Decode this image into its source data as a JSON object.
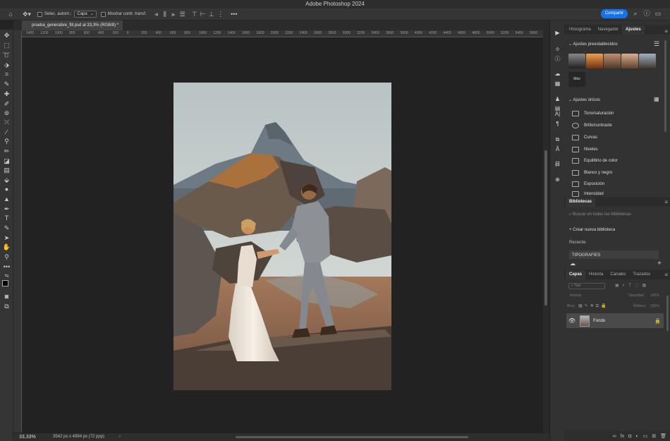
{
  "app": {
    "window_title": "Adobe Photoshop 2024",
    "share_label": "Compartir"
  },
  "options": {
    "auto_select_label": "Selec. autom.:",
    "layer_select": "Capa",
    "show_transform_label": "Mostrar contr. transf."
  },
  "document": {
    "tab_title": "prueba_generative_fill.psd al 33,3% (RGB/8) *",
    "zoom": "33,33%",
    "size_info": "3542 px x 4994 px (72 ppp)"
  },
  "ruler": {
    "ticks": [
      "1400",
      "1200",
      "1000",
      "800",
      "600",
      "400",
      "200",
      "0",
      "200",
      "400",
      "600",
      "800",
      "1000",
      "1200",
      "1400",
      "1600",
      "1800",
      "2000",
      "2200",
      "2400",
      "2600",
      "2800",
      "3000",
      "3200",
      "3400",
      "3600",
      "3800",
      "4000",
      "4200",
      "4400",
      "4600",
      "4800",
      "5000",
      "5200",
      "5400",
      "5600"
    ]
  },
  "panels": {
    "top_tabs": [
      "Histograma",
      "Navegador",
      "Ajustes"
    ],
    "presets_title": "Ajustes preestablecidos",
    "more_label": "Más",
    "single_title": "Ajustes únicos",
    "adjustments": [
      "Tono/saturación",
      "Brillo/contraste",
      "Curvas",
      "Niveles",
      "Equilibrio de color",
      "Blanco y negro",
      "Exposición",
      "Intensidad"
    ],
    "libraries_title": "Bibliotecas",
    "libraries_search_placeholder": "Buscar en todas las bibliotecas",
    "create_library": "Crear nueva biblioteca",
    "recent_label": "Reciente",
    "library_item": "TIPOGRAFIES",
    "layer_tabs": [
      "Capas",
      "Historia",
      "Canales",
      "Trazados"
    ],
    "filter_placeholder": "Tipo",
    "blend_mode": "Normal",
    "opacity_label": "Opacidad:",
    "opacity_value": "100%",
    "lock_label": "Bloq.:",
    "fill_label": "Relleno:",
    "fill_value": "100%",
    "layer_name": "Fondo"
  },
  "colors": {
    "accent": "#1473e6",
    "bg": "#232323",
    "panel": "#323232"
  }
}
